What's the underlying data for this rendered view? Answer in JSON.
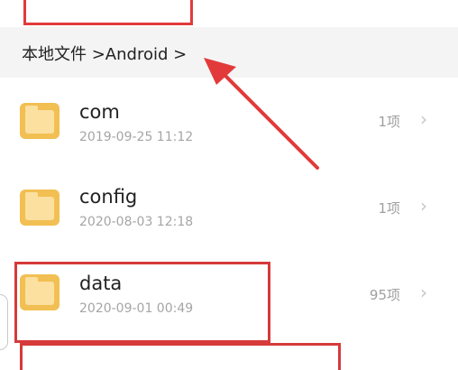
{
  "breadcrumb": {
    "path": "本地文件 >Android >"
  },
  "folders": [
    {
      "name": "com",
      "date": "2019-09-25 11:12",
      "count": "1项",
      "chevron": "chevron-right-icon"
    },
    {
      "name": "config",
      "date": "2020-08-03 12:18",
      "count": "1项",
      "chevron": "chevron-right-icon"
    },
    {
      "name": "data",
      "date": "2020-09-01 00:49",
      "count": "95项",
      "chevron": "chevron-right-icon"
    }
  ],
  "colors": {
    "annotation_red": "#e23a3a",
    "folder_back": "#f2bf52",
    "folder_front": "#fbe0a0",
    "breadcrumb_bg": "#f4f4f4"
  },
  "icons": {
    "folder": "folder-icon",
    "chevron": "chevron-right-icon",
    "annotation_arrow": "arrow-annotation"
  }
}
